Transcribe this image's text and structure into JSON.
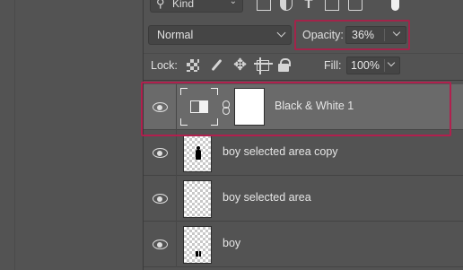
{
  "filter": {
    "kind_label": "Kind",
    "icons": [
      "image-filter-icon",
      "adjustment-filter-icon",
      "type-filter-icon",
      "shape-filter-icon",
      "smart-object-filter-icon"
    ]
  },
  "blend": {
    "mode": "Normal"
  },
  "opacity": {
    "label": "Opacity:",
    "value": "36%"
  },
  "lock": {
    "label": "Lock:",
    "icons": [
      "lock-transparent-pixels-icon",
      "lock-image-pixels-icon",
      "lock-position-icon",
      "lock-artboard-icon",
      "lock-all-icon"
    ]
  },
  "fill": {
    "label": "Fill:",
    "value": "100%"
  },
  "layers": [
    {
      "name": "Black & White 1",
      "type": "adjustment",
      "selected": true,
      "visible": true
    },
    {
      "name": "boy selected area copy",
      "type": "pixel",
      "selected": false,
      "visible": true
    },
    {
      "name": "boy selected area",
      "type": "pixel",
      "selected": false,
      "visible": true
    },
    {
      "name": "boy",
      "type": "pixel",
      "selected": false,
      "visible": true
    }
  ],
  "colors": {
    "panel": "#535353",
    "selected_row": "#6a6a6a",
    "highlight": "#b1204e"
  }
}
